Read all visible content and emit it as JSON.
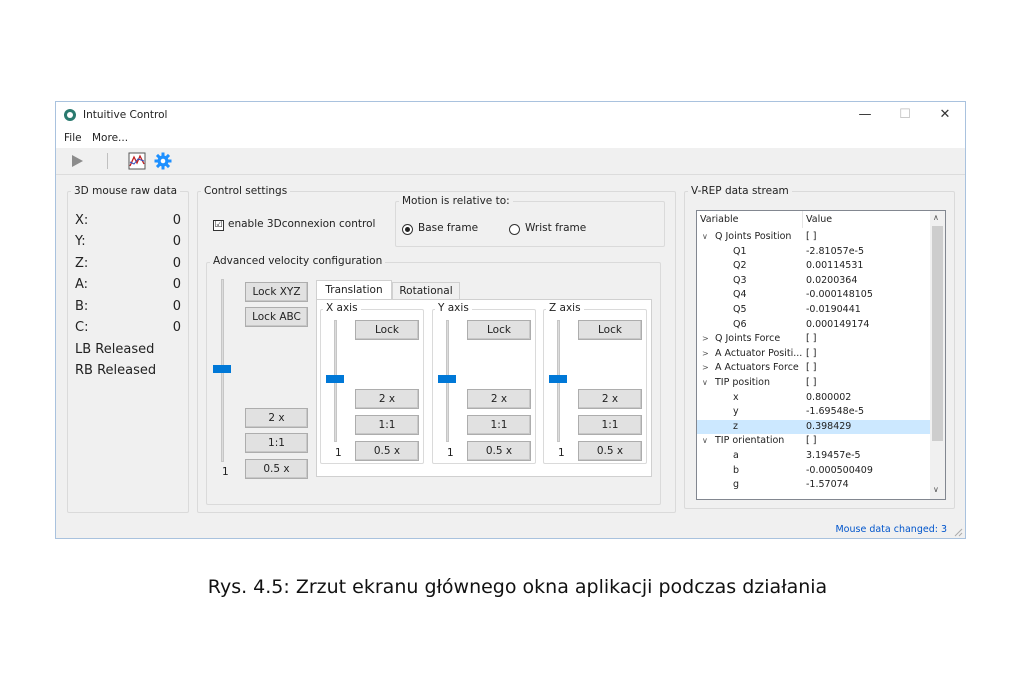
{
  "window": {
    "title": "Intuitive Control",
    "controls": {
      "minimize": "—",
      "maximize": "☐",
      "close": "✕"
    }
  },
  "menu": {
    "file": "File",
    "more": "More..."
  },
  "toolbar": {
    "icons": [
      "play-icon",
      "chart-icon",
      "gear-icon"
    ]
  },
  "raw_data": {
    "title": "3D mouse raw data",
    "rows": [
      {
        "label": "X:",
        "value": "0"
      },
      {
        "label": "Y:",
        "value": "0"
      },
      {
        "label": "Z:",
        "value": "0"
      },
      {
        "label": "A:",
        "value": "0"
      },
      {
        "label": "B:",
        "value": "0"
      },
      {
        "label": "C:",
        "value": "0"
      }
    ],
    "lb": "LB Released",
    "rb": "RB Released"
  },
  "control": {
    "title": "Control settings",
    "enable_label": "enable 3Dconnexion control",
    "enable_mark": "☑",
    "motion": {
      "title": "Motion is relative to:",
      "base": "Base frame",
      "wrist": "Wrist frame"
    },
    "advanced": {
      "title": "Advanced velocity configuration",
      "lock_xyz": "Lock XYZ",
      "lock_abc": "Lock ABC",
      "btn_2x": "2 x",
      "btn_1to1": "1:1",
      "btn_05x": "0.5 x",
      "main_slider_label": "1",
      "tabs": {
        "translation": "Translation",
        "rotational": "Rotational"
      },
      "axes": [
        {
          "title": "X axis",
          "lock": "Lock",
          "b2x": "2 x",
          "b11": "1:1",
          "b05": "0.5 x",
          "slider_label": "1"
        },
        {
          "title": "Y axis",
          "lock": "Lock",
          "b2x": "2 x",
          "b11": "1:1",
          "b05": "0.5 x",
          "slider_label": "1"
        },
        {
          "title": "Z axis",
          "lock": "Lock",
          "b2x": "2 x",
          "b11": "1:1",
          "b05": "0.5 x",
          "slider_label": "1"
        }
      ]
    }
  },
  "vrep": {
    "title": "V-REP data stream",
    "columns": {
      "variable": "Variable",
      "value": "Value"
    },
    "rows": [
      {
        "arrow": "∨",
        "var": "Q Joints Position",
        "val": "[ ]"
      },
      {
        "arrow": "",
        "var": "Q1",
        "val": "-2.81057e-5"
      },
      {
        "arrow": "",
        "var": "Q2",
        "val": "0.00114531"
      },
      {
        "arrow": "",
        "var": "Q3",
        "val": "0.0200364"
      },
      {
        "arrow": "",
        "var": "Q4",
        "val": "-0.000148105"
      },
      {
        "arrow": "",
        "var": "Q5",
        "val": "-0.0190441"
      },
      {
        "arrow": "",
        "var": "Q6",
        "val": "0.000149174"
      },
      {
        "arrow": ">",
        "var": "Q Joints Force",
        "val": "[ ]"
      },
      {
        "arrow": ">",
        "var": "A Actuator Positi...",
        "val": "[ ]"
      },
      {
        "arrow": ">",
        "var": "A Actuators Force",
        "val": "[ ]"
      },
      {
        "arrow": "∨",
        "var": "TIP position",
        "val": "[ ]"
      },
      {
        "arrow": "",
        "var": "x",
        "val": "0.800002"
      },
      {
        "arrow": "",
        "var": "y",
        "val": "-1.69548e-5"
      },
      {
        "arrow": "",
        "var": "z",
        "val": "0.398429"
      },
      {
        "arrow": "∨",
        "var": "TIP orientation",
        "val": "[ ]"
      },
      {
        "arrow": "",
        "var": "a",
        "val": "3.19457e-5"
      },
      {
        "arrow": "",
        "var": "b",
        "val": "-0.000500409"
      },
      {
        "arrow": "",
        "var": "g",
        "val": "-1.57074"
      }
    ]
  },
  "status": "Mouse data changed: 3",
  "caption": "Rys. 4.5: Zrzut ekranu głównego okna aplikacji podczas działania"
}
